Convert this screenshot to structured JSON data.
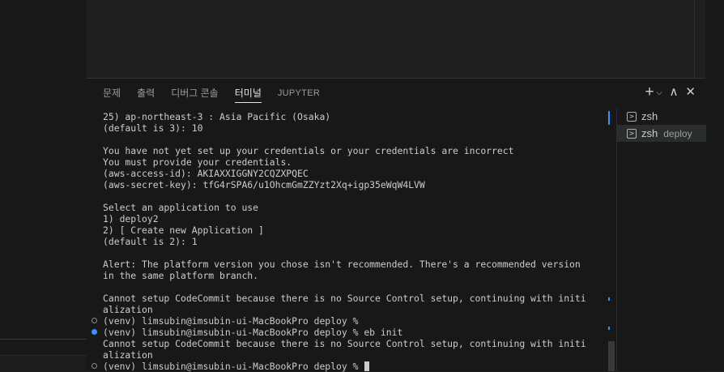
{
  "panel": {
    "tabs": [
      {
        "label": "문제"
      },
      {
        "label": "출력"
      },
      {
        "label": "디버그 콘솔"
      },
      {
        "label": "터미널"
      },
      {
        "label": "JUPYTER"
      }
    ],
    "active_tab": "터미널",
    "actions": {
      "new_terminal": "+",
      "dropdown": "⌵",
      "maximize": "∧",
      "close": "✕"
    }
  },
  "terminal": {
    "lines": [
      "25) ap-northeast-3 : Asia Pacific (Osaka)",
      "(default is 3): 10",
      "",
      "You have not yet set up your credentials or your credentials are incorrect",
      "You must provide your credentials.",
      "(aws-access-id): AKIAXXIGGNY2CQZXPQEC",
      "(aws-secret-key): tfG4rSPA6/u1OhcmGmZZYzt2Xq+igp35eWqW4LVW",
      "",
      "Select an application to use",
      "1) deploy2",
      "2) [ Create new Application ]",
      "(default is 2): 1",
      "",
      "Alert: The platform version you chose isn't recommended. There's a recommended version",
      "in the same platform branch.",
      "",
      "Cannot setup CodeCommit because there is no Source Control setup, continuing with initi",
      "alization",
      "(venv) limsubin@imsubin-ui-MacBookPro deploy %",
      "(venv) limsubin@imsubin-ui-MacBookPro deploy % eb init",
      "Cannot setup CodeCommit because there is no Source Control setup, continuing with initi",
      "alization",
      "(venv) limsubin@imsubin-ui-MacBookPro deploy % "
    ]
  },
  "terminal_list": {
    "items": [
      {
        "name": "zsh",
        "sub": ""
      },
      {
        "name": "zsh",
        "sub": "deploy"
      }
    ]
  },
  "colors": {
    "accent": "#3794ff",
    "panel_bg": "#181818",
    "text": "#cccccc"
  }
}
